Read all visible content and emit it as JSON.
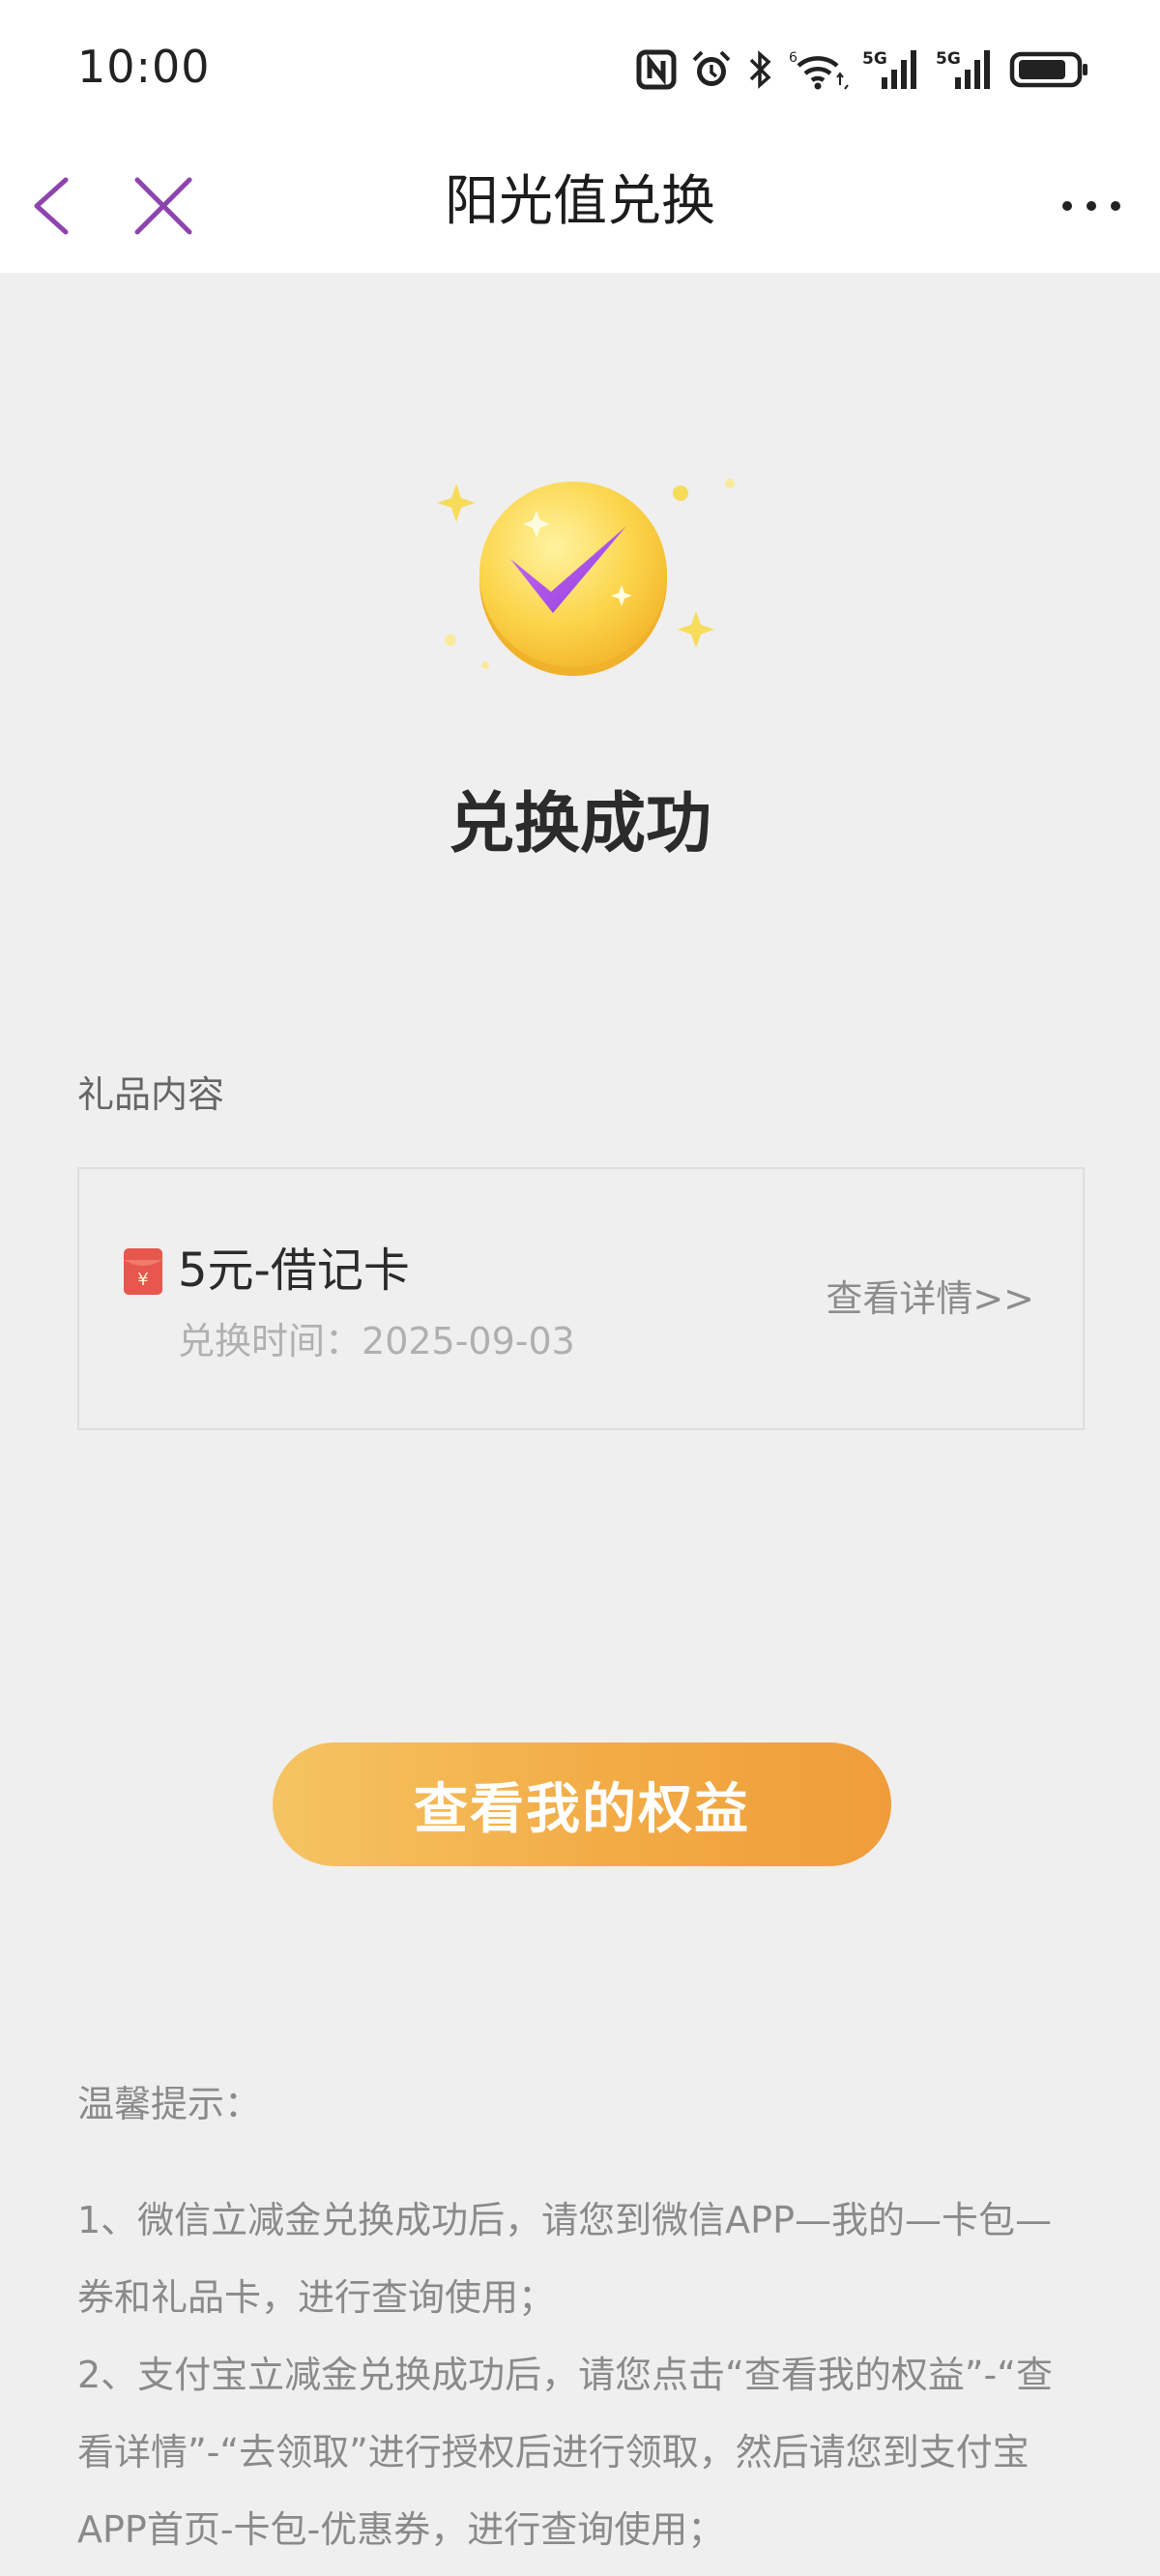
{
  "status_bar": {
    "time": "10:00",
    "icons": [
      "nfc-icon",
      "alarm-icon",
      "bluetooth-icon",
      "wifi-icon",
      "signal-5g-icon",
      "signal-5g-icon",
      "battery-icon"
    ],
    "signal_label_1": "5G",
    "signal_label_2": "5G",
    "wifi_label": "6"
  },
  "nav": {
    "title": "阳光值兑换",
    "back_icon": "chevron-left-icon",
    "close_icon": "close-icon",
    "more_icon": "more-icon",
    "accent_color": "#8e44ad"
  },
  "result": {
    "title": "兑换成功",
    "icon": "success-check-coin-icon"
  },
  "gift": {
    "section_label": "礼品内容",
    "name": "5元-借记卡",
    "time_label": "兑换时间：",
    "time_value": "2025-09-03",
    "detail_link": "查看详情>>",
    "icon": "red-envelope-icon"
  },
  "primary_button": {
    "label": "查看我的权益",
    "color_start": "#f5c462",
    "color_end": "#ef9d3a"
  },
  "tips": {
    "title": "温馨提示：",
    "items": [
      "1、微信立减金兑换成功后，请您到微信APP—我的—卡包—券和礼品卡，进行查询使用；",
      "2、支付宝立减金兑换成功后，请您点击“查看我的权益”-“查看详情”-“去领取”进行授权后进行领取，然后请您到支付宝APP首页-卡包-优惠券，进行查询使用；"
    ]
  }
}
